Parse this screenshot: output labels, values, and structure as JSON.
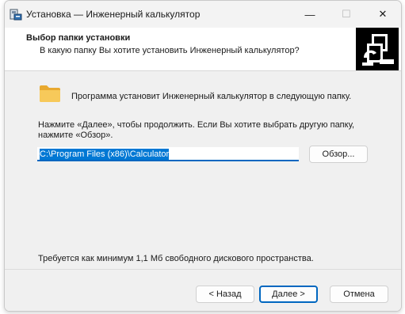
{
  "window": {
    "title": "Установка — Инженерный калькулятор",
    "minimize_glyph": "—",
    "maximize_glyph": "☐",
    "close_glyph": "✕"
  },
  "header": {
    "title": "Выбор папки установки",
    "subtitle": "В какую папку Вы хотите установить Инженерный калькулятор?"
  },
  "content": {
    "intro": "Программа установит Инженерный калькулятор в следующую папку.",
    "instructions": "Нажмите «Далее», чтобы продолжить. Если Вы хотите выбрать другую папку, нажмите «Обзор».",
    "path_value": "C:\\Program Files (x86)\\Calculator",
    "browse_label": "Обзор...",
    "requirement": "Требуется как минимум 1,1 Мб свободного дискового пространства."
  },
  "footer": {
    "back_label": "< Назад",
    "next_label": "Далее >",
    "cancel_label": "Отмена"
  },
  "icons": {
    "app": "installer-app-icon",
    "folder": "folder-icon",
    "logo": "computer-install-logo-icon"
  },
  "colors": {
    "accent": "#0067c0",
    "selection": "#0078d4",
    "folder": "#f4c04e"
  }
}
